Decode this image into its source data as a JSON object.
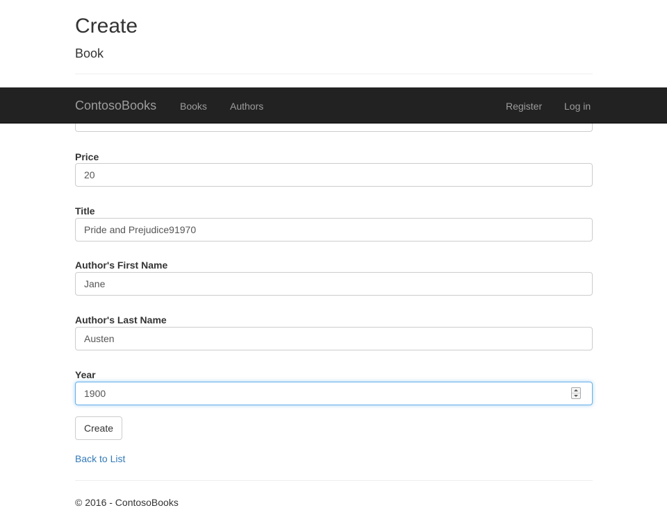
{
  "header": {
    "title": "Create",
    "subtitle": "Book"
  },
  "navbar": {
    "brand": "ContosoBooks",
    "links": [
      "Books",
      "Authors"
    ],
    "right_links": [
      "Register",
      "Log in"
    ],
    "background": "#222222",
    "link_color": "#9d9d9d"
  },
  "form": {
    "price": {
      "label": "Price",
      "value": "20"
    },
    "title": {
      "label": "Title",
      "value": "Pride and Prejudice91970"
    },
    "first_name": {
      "label": "Author's First Name",
      "value": "Jane"
    },
    "last_name": {
      "label": "Author's Last Name",
      "value": "Austen"
    },
    "year": {
      "label": "Year",
      "value": "1900"
    },
    "submit_label": "Create",
    "focus_color": "#66afe9"
  },
  "back_link": "Back to List",
  "footer": {
    "text": "© 2016 - ContosoBooks"
  },
  "icons": {
    "year_spinner": "spinner-arrows-icon"
  },
  "colors": {
    "link": "#337ab7",
    "border": "#cccccc"
  }
}
